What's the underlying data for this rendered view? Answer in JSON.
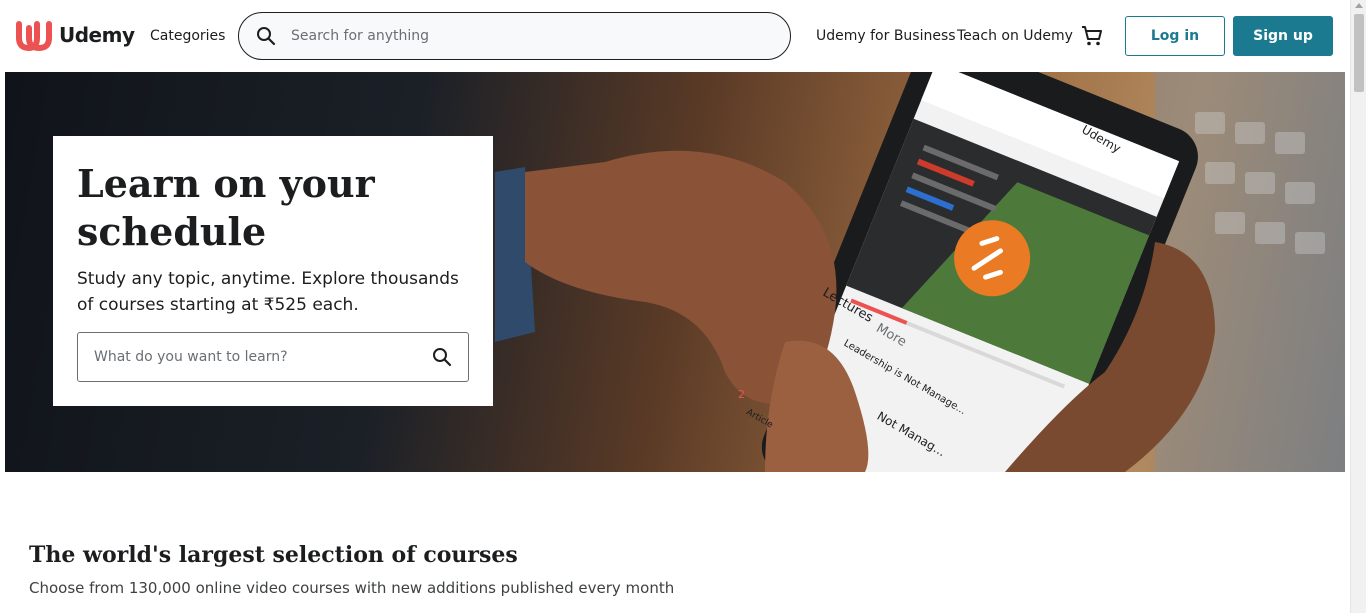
{
  "header": {
    "logo_text": "Udemy",
    "categories_label": "Categories",
    "search_placeholder": "Search for anything",
    "business_link": "Udemy for Business",
    "teach_link": "Teach on Udemy",
    "login_label": "Log in",
    "signup_label": "Sign up"
  },
  "hero": {
    "title": "Learn on your schedule",
    "subtitle": "Study any topic, anytime. Explore thousands of courses starting at ₹525 each.",
    "search_placeholder": "What do you want to learn?",
    "phone_screen": {
      "brand": "Udemy",
      "tab_lectures": "Lectures",
      "tab_more": "More",
      "item_text": "Leadership is Not Manage...",
      "item_title": "Not Manag...",
      "article_label": "Article",
      "lecture_num": "2"
    }
  },
  "section": {
    "title": "The world's largest selection of courses",
    "subtitle": "Choose from 130,000 online video courses with new additions published every month"
  },
  "colors": {
    "brand_red": "#ec5252",
    "accent_teal": "#1c7a90",
    "text": "#1c1d1f"
  }
}
